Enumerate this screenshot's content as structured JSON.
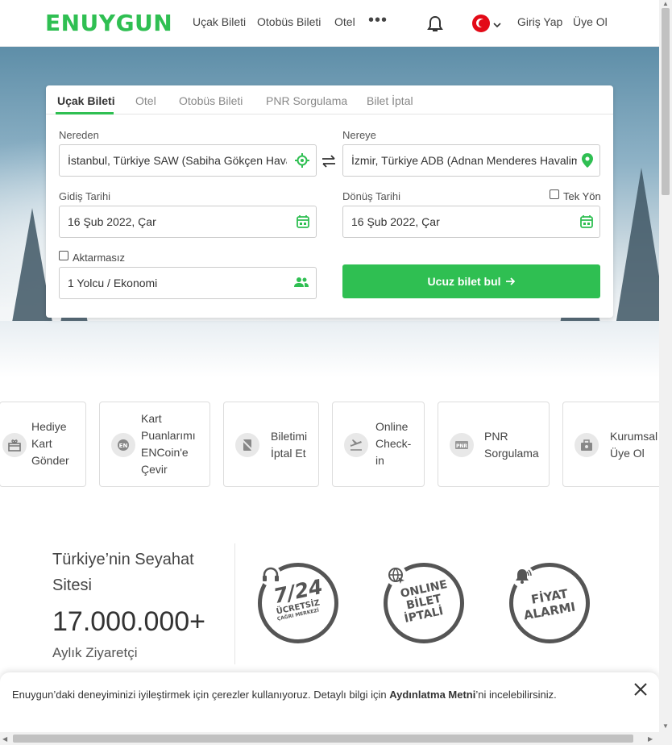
{
  "brand": {
    "logo": "ENUYGUN",
    "accent": "#2fbf52"
  },
  "header": {
    "nav": [
      "Uçak Bileti",
      "Otobüs Bileti",
      "Otel"
    ],
    "more": "•••",
    "login": "Giriş Yap",
    "signup": "Üye Ol"
  },
  "search": {
    "tabs": [
      "Uçak Bileti",
      "Otel",
      "Otobüs Bileti",
      "PNR Sorgulama",
      "Bilet İptal"
    ],
    "from_label": "Nereden",
    "from_value": "İstanbul, Türkiye SAW (Sabiha Gökçen Hava",
    "to_label": "Nereye",
    "to_value": "İzmir, Türkiye ADB (Adnan Menderes Havalim",
    "depart_label": "Gidiş Tarihi",
    "depart_value": "16 Şub 2022, Çar",
    "return_label": "Dönüş Tarihi",
    "one_way_label": "Tek Yön",
    "return_value": "16 Şub 2022, Çar",
    "direct_label": "Aktarmasız",
    "passengers_value": "1 Yolcu / Ekonomi",
    "submit_label": "Ucuz bilet bul"
  },
  "quick_links": [
    {
      "lines": [
        "Hediye",
        "Kart",
        "Gönder"
      ],
      "icon": "gift-card-icon"
    },
    {
      "lines": [
        "Kart",
        "Puanlarımı",
        "ENCoin'e",
        "Çevir"
      ],
      "icon": "encoin-icon"
    },
    {
      "lines": [
        "Biletimi",
        "İptal Et"
      ],
      "icon": "cancel-ticket-icon"
    },
    {
      "lines": [
        "Online",
        "Check-",
        "in"
      ],
      "icon": "plane-checkin-icon"
    },
    {
      "lines": [
        "PNR",
        "Sorgulama"
      ],
      "icon": "pnr-icon"
    },
    {
      "lines": [
        "Kurumsal",
        "Üye Ol"
      ],
      "icon": "corporate-icon"
    }
  ],
  "stats": {
    "title": "Türkiye’nin Seyahat Sitesi",
    "number": "17.000.000+",
    "subtitle": "Aylık Ziyaretçi"
  },
  "badges": [
    {
      "line1": "7/24",
      "line2": "ÜCRETSİZ",
      "line3": "ÇAĞRI MERKEZİ"
    },
    {
      "line1": "ONLINE",
      "line2": "BİLET",
      "line3": "İPTALİ"
    },
    {
      "line1": "FİYAT",
      "line2": "ALARMI"
    }
  ],
  "cookie": {
    "text_before": "Enuygun’daki deneyiminizi iyileştirmek için çerezler kullanıyoruz. Detaylı bilgi için ",
    "link": "Aydınlatma Metni",
    "text_after": "’ni incelebilirsiniz."
  }
}
